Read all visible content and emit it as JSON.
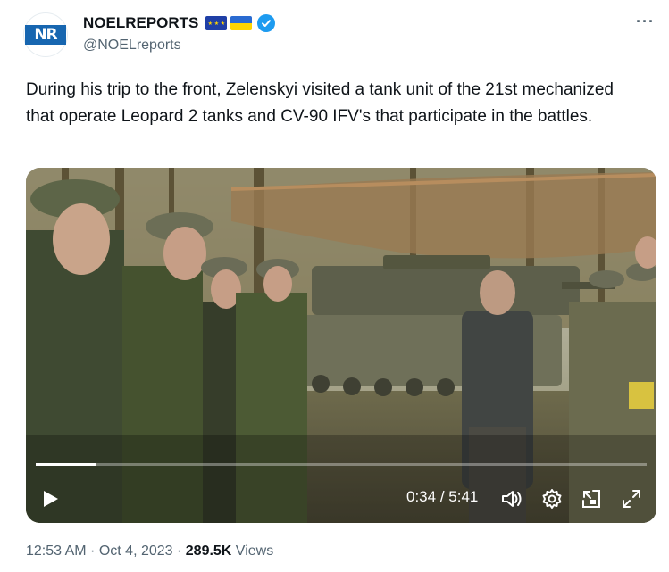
{
  "author": {
    "display_name": "NOELREPORTS",
    "handle": "@NOELreports",
    "avatar_text": "NR",
    "flags": [
      "eu-flag",
      "ukraine-flag"
    ],
    "verified": true
  },
  "tweet": {
    "text": "During his trip to the front, Zelenskyi visited a tank unit of the 21st mechanized that operate Leopard 2 tanks and CV-90 IFV's that participate in the battles."
  },
  "video": {
    "current_time": "0:34",
    "separator": " / ",
    "duration": "5:41",
    "progress": 0.1
  },
  "meta": {
    "time": "12:53 AM",
    "dot1": " · ",
    "date": "Oct 4, 2023",
    "dot2": " · ",
    "views_count": "289.5K",
    "views_label": " Views"
  },
  "colors": {
    "verified": "#1d9bf0",
    "avatar_bg": "#1766b0",
    "secondary_text": "#536471"
  }
}
